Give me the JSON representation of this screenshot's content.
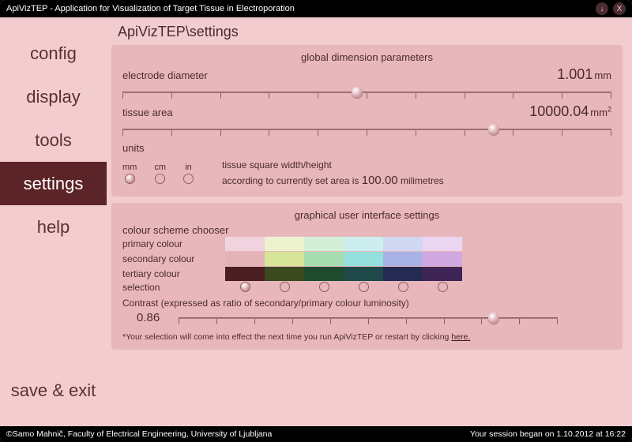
{
  "titlebar": {
    "title": "ApiVizTEP - Application for Visualization of Target Tissue in Electroporation",
    "minimize": "↓",
    "close": "X"
  },
  "sidebar": {
    "items": [
      "config",
      "display",
      "tools",
      "settings",
      "help"
    ],
    "active_index": 3,
    "save_exit": "save & exit"
  },
  "breadcrumb": "ApiVizTEP\\settings",
  "panel_global": {
    "title": "global dimension parameters",
    "electrode_label": "electrode diameter",
    "electrode_value": "1.001",
    "electrode_unit": "mm",
    "electrode_slider_pct": 48,
    "tissue_label": "tissue area",
    "tissue_value": "10000.04",
    "tissue_unit_html": "mm²",
    "tissue_slider_pct": 76,
    "units_label": "units",
    "unit_options": [
      "mm",
      "cm",
      "in"
    ],
    "unit_selected_index": 0,
    "units_desc_line1": "tissue square width/height",
    "units_desc_line2a": "according to currently set area is ",
    "units_desc_value": "100.00",
    "units_desc_line2b": " milimetres"
  },
  "panel_gui": {
    "title": "graphical user interface settings",
    "chooser_label": "colour scheme chooser",
    "rows": [
      {
        "label": "primary colour",
        "swatches": [
          "#f1d3df",
          "#eef3cf",
          "#d4efd8",
          "#cdeeee",
          "#d2d7f1",
          "#ebd6f1"
        ]
      },
      {
        "label": "secondary colour",
        "swatches": [
          "#e4b3b8",
          "#d6e59a",
          "#a7dcb0",
          "#95e0dc",
          "#a7b2e6",
          "#d2a8e3"
        ]
      },
      {
        "label": "tertiary colour",
        "swatches": [
          "#4a1e22",
          "#3b4a1e",
          "#1e4a2e",
          "#1e4948",
          "#242a52",
          "#3f2456"
        ]
      }
    ],
    "selection_label": "selection",
    "selection_index": 0,
    "contrast_label": "Contrast (expressed as ratio of secondary/primary colour luminosity)",
    "contrast_value": "0.86",
    "contrast_slider_pct": 83,
    "note_prefix": "*Your selection will come into effect the next time you run ApiVizTEP or restart by clicking ",
    "note_link": "here."
  },
  "footer": {
    "left": "©Samo Mahnič, Faculty of Electrical Engineering, University of Ljubljana",
    "right": "Your session began on 1.10.2012 at 16:22"
  }
}
